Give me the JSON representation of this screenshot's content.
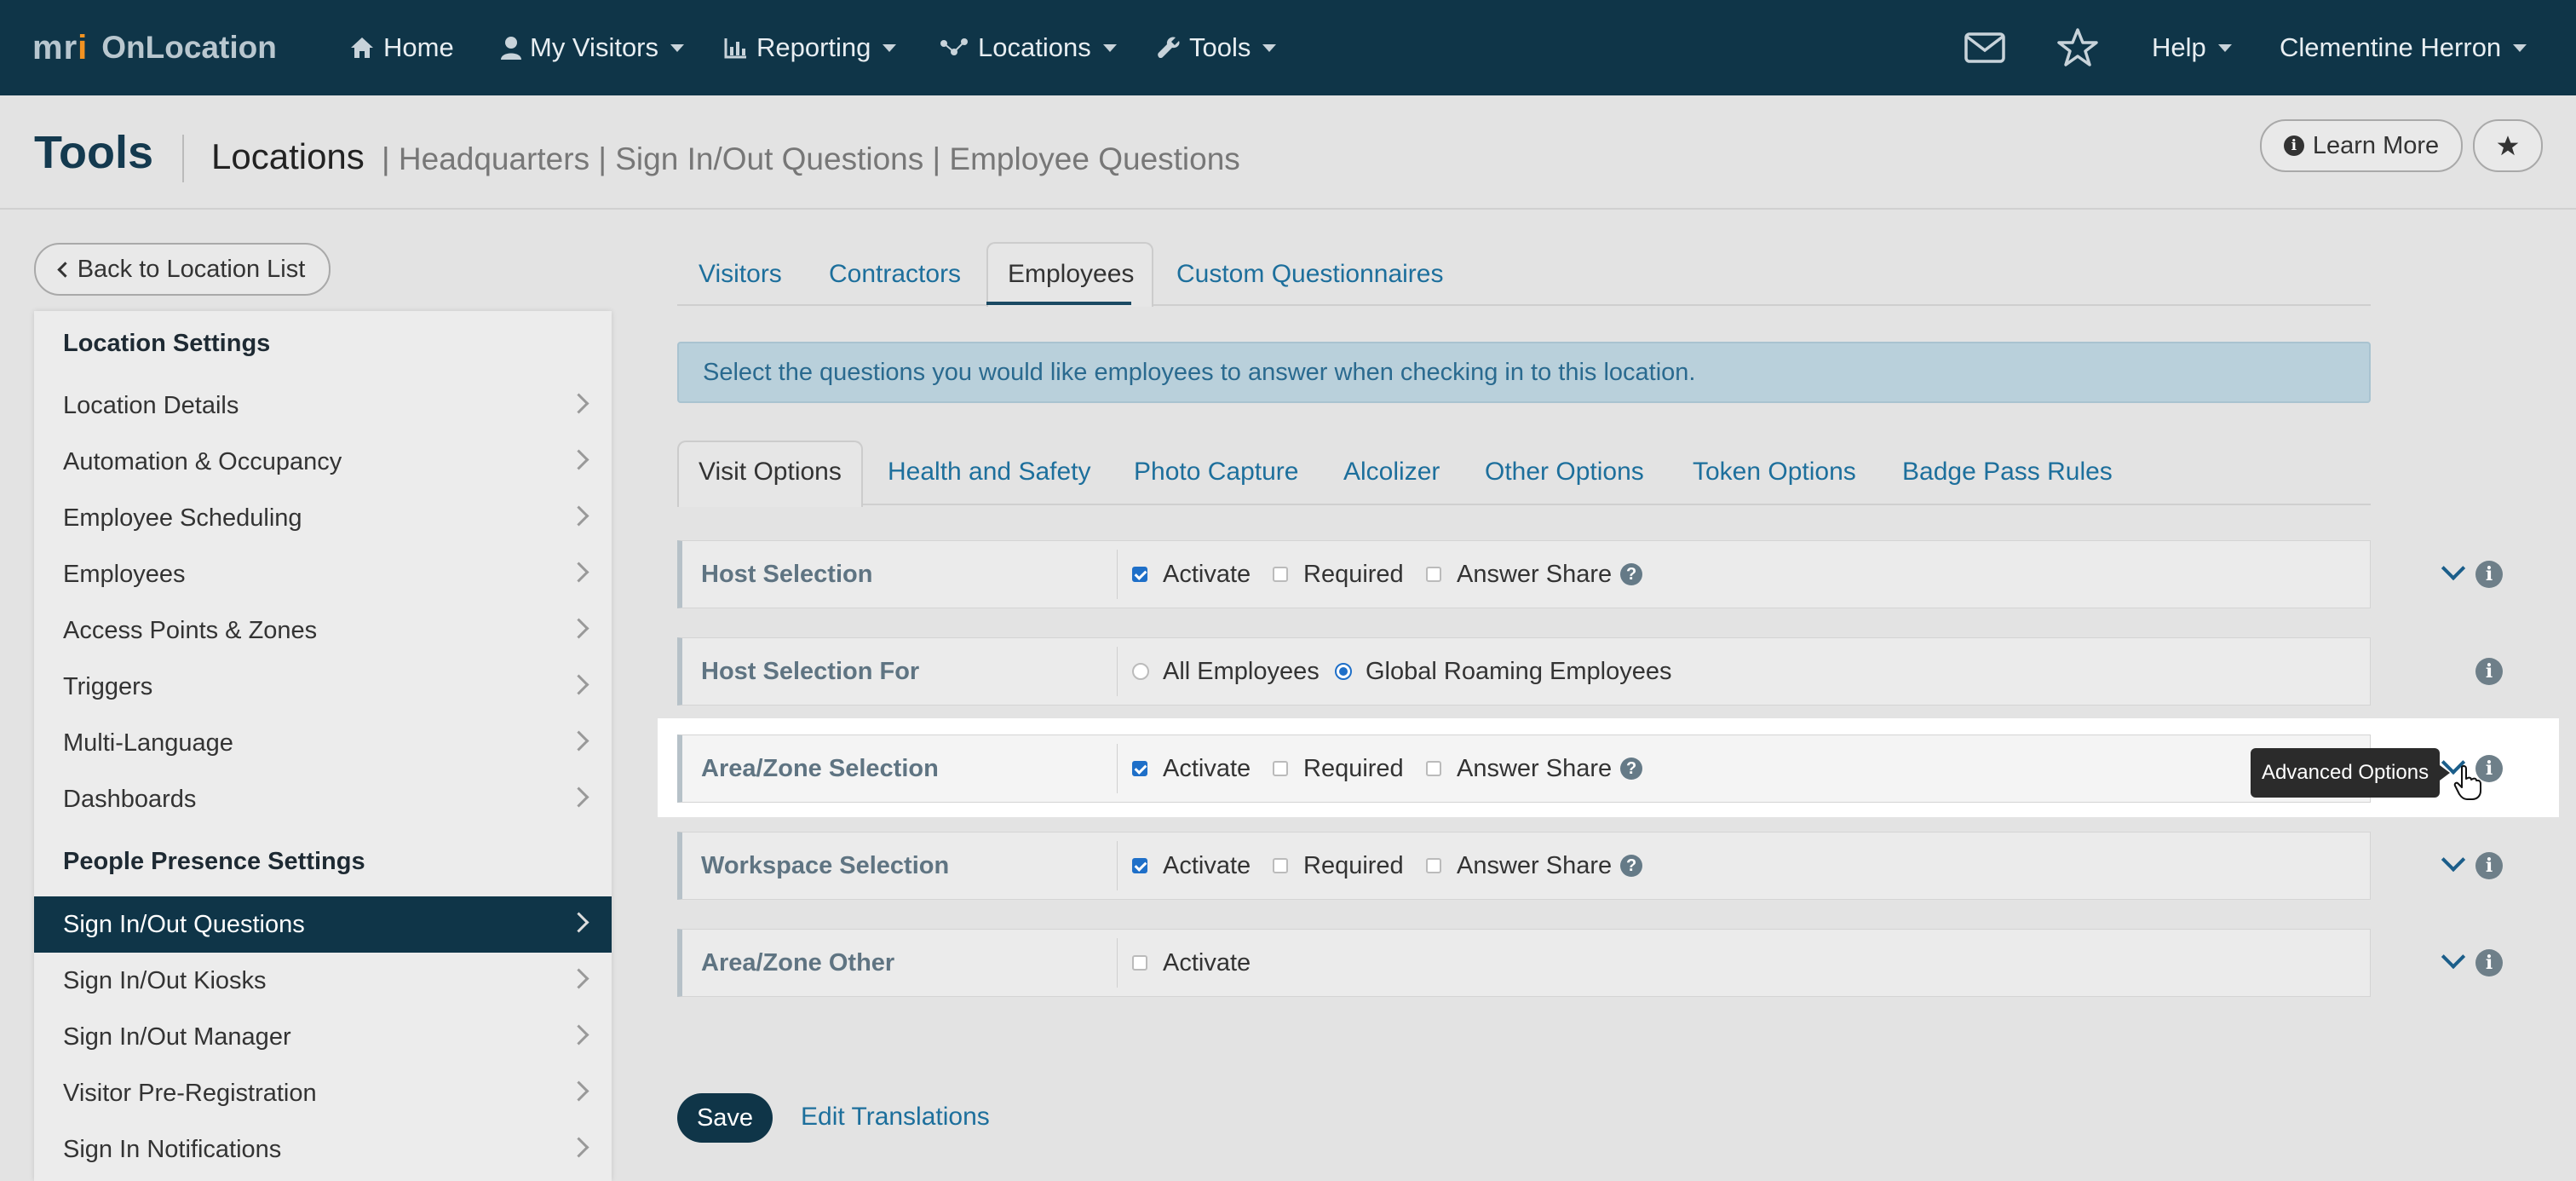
{
  "app": {
    "logo_mark": "mri",
    "logo_text": "OnLocation"
  },
  "topnav": {
    "items": [
      {
        "label": "Home",
        "icon": "home-icon"
      },
      {
        "label": "My Visitors",
        "icon": "user-icon"
      },
      {
        "label": "Reporting",
        "icon": "chart-icon"
      },
      {
        "label": "Locations",
        "icon": "locations-icon"
      },
      {
        "label": "Tools",
        "icon": "wrench-icon"
      }
    ],
    "mail_icon": "envelope-icon",
    "star_icon": "star-icon",
    "help_label": "Help",
    "user_name": "Clementine Herron"
  },
  "header": {
    "title": "Tools",
    "breadcrumb_main": "Locations",
    "breadcrumb_rest": "| Headquarters | Sign In/Out Questions | Employee Questions",
    "learn_more_label": "Learn More",
    "favorite_icon": "star-icon"
  },
  "sidebar": {
    "back_label": "Back to Location List",
    "section1_title": "Location Settings",
    "section1_items": [
      "Location Details",
      "Automation & Occupancy",
      "Employee Scheduling",
      "Employees",
      "Access Points & Zones",
      "Triggers",
      "Multi-Language",
      "Dashboards"
    ],
    "section2_title": "People Presence Settings",
    "section2_items": [
      "Sign In/Out Questions",
      "Sign In/Out Kiosks",
      "Sign In/Out Manager",
      "Visitor Pre-Registration",
      "Sign In Notifications"
    ],
    "active_item": "Sign In/Out Questions"
  },
  "main": {
    "tabs": [
      "Visitors",
      "Contractors",
      "Employees",
      "Custom Questionnaires"
    ],
    "active_tab": "Employees",
    "banner": "Select the questions you would like employees to answer when checking in to this location.",
    "subtabs": [
      "Visit Options",
      "Health and Safety",
      "Photo Capture",
      "Alcolizer",
      "Other Options",
      "Token Options",
      "Badge Pass Rules"
    ],
    "active_subtab": "Visit Options",
    "option_labels": {
      "activate": "Activate",
      "required": "Required",
      "answer_share": "Answer Share",
      "all_employees": "All Employees",
      "global_roaming": "Global Roaming Employees",
      "help_glyph": "?",
      "info_glyph": "i"
    },
    "rows": [
      {
        "label": "Host Selection",
        "activate": true,
        "required": false,
        "answer_share": false
      },
      {
        "label": "Host Selection For",
        "radio_selected": "Global Roaming Employees"
      },
      {
        "label": "Area/Zone Selection",
        "activate": true,
        "required": false,
        "answer_share": false
      },
      {
        "label": "Workspace Selection",
        "activate": true,
        "required": false,
        "answer_share": false
      },
      {
        "label": "Area/Zone Other",
        "activate": false
      }
    ],
    "tooltip": "Advanced Options",
    "save_label": "Save",
    "edit_translations_label": "Edit Translations"
  }
}
